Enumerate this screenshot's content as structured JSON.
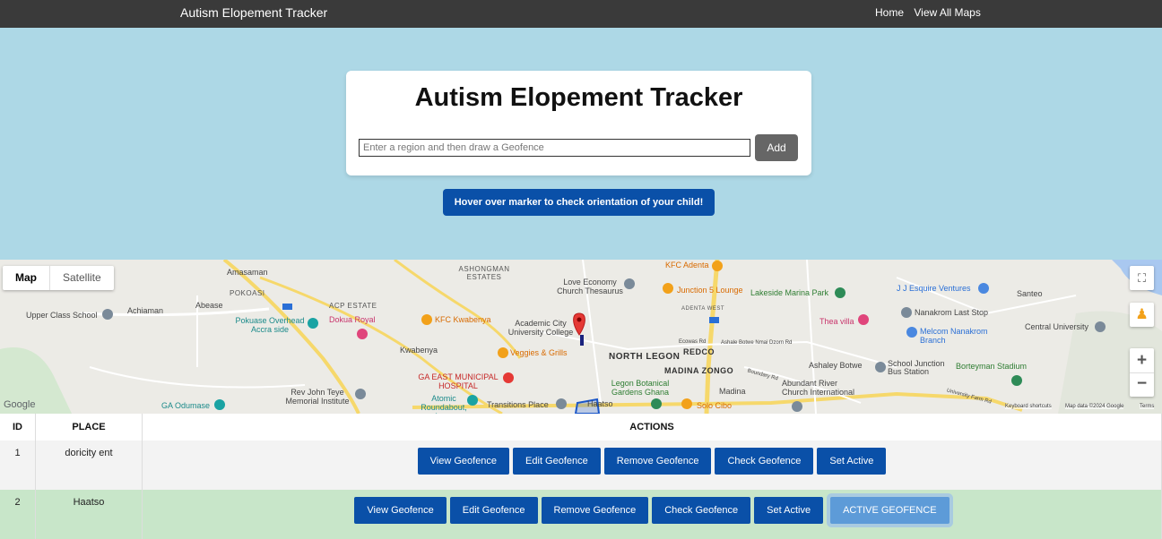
{
  "navbar": {
    "brand": "Autism Elopement Tracker",
    "links": [
      "Home",
      "View All Maps"
    ]
  },
  "card": {
    "title": "Autism Elopement Tracker",
    "input_placeholder": "Enter a region and then draw a Geofence",
    "add_label": "Add"
  },
  "hint_button": "Hover over marker to check orientation of your child!",
  "map": {
    "type_options": [
      "Map",
      "Satellite"
    ],
    "labels": {
      "amasaman": "Amasaman",
      "pokoasi": "POKOASI",
      "acp": "ACP ESTATE",
      "ashongman": "ASHONGMAN ESTATES",
      "love_economy": "Love Economy Church Thesaurus",
      "kfc_adenta": "KFC Adenta",
      "junction5": "Junction 5 Lounge",
      "lakeside": "Lakeside Marina Park",
      "jj_esquire": "J J Esquire Ventures",
      "santeo": "Santeo",
      "upper_class": "Upper Class School",
      "achiaman": "Achiaman",
      "abease": "Abease",
      "pokuase": "Pokuase Overhead Accra side",
      "dokua": "Dokua Royal",
      "kfc_kwabenya": "KFC Kwabenya",
      "academic_city": "Academic City University College",
      "adenta_west": "ADENTA WEST",
      "thea": "Thea villa",
      "nanakrom_last": "Nanakrom Last Stop",
      "melcom": "Melcom Nanakrom Branch",
      "central_uni": "Central University",
      "kwabenya": "Kwabenya",
      "veggies": "Veggies & Grills",
      "north_legon": "NORTH LEGON",
      "redco": "REDCO",
      "ecowas": "Ecowas Rd",
      "ashale": "Ashale Botwe Nmai Dzorn Rd",
      "ashaley_botwe": "Ashaley Botwe",
      "school_junction": "School Junction Bus Station",
      "borteyman": "Borteyman Stadium",
      "madina_zongo": "MADINA ZONGO",
      "ga_east": "GA EAST MUNICIPAL HOSPITAL",
      "legon_botanical": "Legon Botanical Gardens Ghana",
      "madina": "Madina",
      "abundant": "Abundant River Church International",
      "rev_john": "Rev John Teye Memorial Institute",
      "ga_odumase": "GA Odumase",
      "atomic": "Atomic Roundabout, Accra",
      "transitions": "Transitions Place",
      "haatso": "Haatso",
      "solo": "Solo Cibo",
      "boundary": "Boundary Rd",
      "university_farm": "University Farm Rd",
      "google": "Google",
      "keyboard": "Keyboard shortcuts",
      "mapdata": "Map data ©2024 Google",
      "terms": "Terms"
    }
  },
  "table": {
    "headers": [
      "ID",
      "PLACE",
      "ACTIONS"
    ],
    "rows": [
      {
        "id": "1",
        "place": "doricity ent",
        "actions": [
          "View Geofence",
          "Edit Geofence",
          "Remove Geofence",
          "Check Geofence",
          "Set Active"
        ]
      },
      {
        "id": "2",
        "place": "Haatso",
        "actions": [
          "View Geofence",
          "Edit Geofence",
          "Remove Geofence",
          "Check Geofence",
          "Set Active",
          "ACTIVE GEOFENCE"
        ]
      }
    ]
  },
  "colors": {
    "navbar": "#3a3a3a",
    "page_background": "#add8e6",
    "primary_button": "#0a50a8",
    "active_row": "#c8e6c9",
    "active_geofence": "#5d9bd8"
  }
}
